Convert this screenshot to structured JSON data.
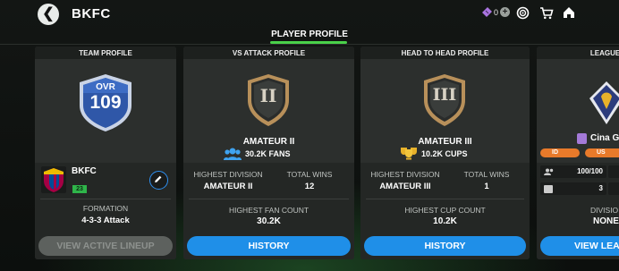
{
  "header": {
    "title": "BKFC",
    "ticket_count": "0"
  },
  "tabs": [
    {
      "label": "PLAYER PROFILE",
      "active": true
    }
  ],
  "team_profile": {
    "heading": "TEAM PROFILE",
    "ovr_label": "OVR",
    "ovr_value": "109",
    "team_name": "BKFC",
    "level_badge": "23",
    "formation_label": "FORMATION",
    "formation_value": "4-3-3 Attack",
    "button": "VIEW ACTIVE LINEUP"
  },
  "vs_attack": {
    "heading": "VS ATTACK PROFILE",
    "rank_numeral": "II",
    "rank_name": "AMATEUR II",
    "fans": "30.2K FANS",
    "highest_division_label": "HIGHEST DIVISION",
    "highest_division_value": "AMATEUR II",
    "total_wins_label": "TOTAL WINS",
    "total_wins_value": "12",
    "highest_count_label": "HIGHEST FAN COUNT",
    "highest_count_value": "30.2K",
    "button": "HISTORY"
  },
  "head_to_head": {
    "heading": "HEAD TO HEAD PROFILE",
    "rank_numeral": "III",
    "rank_name": "AMATEUR III",
    "cups": "10.2K CUPS",
    "highest_division_label": "HIGHEST DIVISION",
    "highest_division_value": "AMATEUR III",
    "total_wins_label": "TOTAL WINS",
    "total_wins_value": "1",
    "highest_count_label": "HIGHEST CUP COUNT",
    "highest_count_value": "10.2K",
    "button": "HISTORY"
  },
  "league": {
    "heading": "LEAGUE PROFILE",
    "name": "Cina G",
    "tag1": "ID",
    "tag2": "US",
    "members": "100/100",
    "stat2": "3",
    "division_label": "DIVISIO",
    "division_value": "NONE",
    "button": "VIEW LEA"
  },
  "colors": {
    "accent_green": "#4ad14a",
    "button_blue": "#1f8fe8",
    "shield_blue": "#2f57a8",
    "badge_gold": "#d8b45a"
  }
}
